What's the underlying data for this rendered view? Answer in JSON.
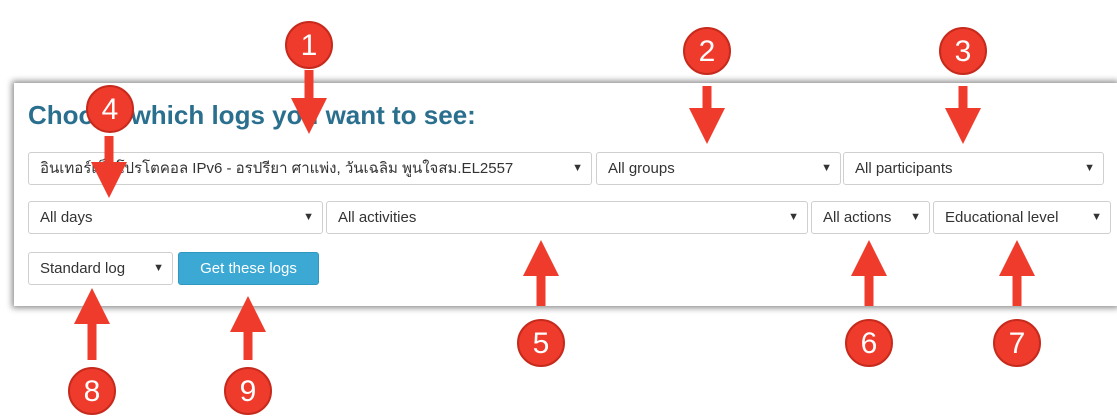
{
  "heading": "Choose which logs you want to see:",
  "filters": {
    "course": "อินเทอร์เน็ตโปรโตคอล IPv6 - อรปรียา ศาแพ่ง, วันเฉลิม พูนใจสม.EL2557",
    "groups": "All groups",
    "participants": "All participants",
    "days": "All days",
    "activities": "All activities",
    "actions": "All actions",
    "educational_level": "Educational level",
    "log_type": "Standard log"
  },
  "dropdown_glyph": "▼",
  "button_label": "Get these logs",
  "callouts": [
    "1",
    "2",
    "3",
    "4",
    "5",
    "6",
    "7",
    "8",
    "9"
  ],
  "colors": {
    "heading": "#2b6f8f",
    "button": "#3ba9d3",
    "callout": "#ef3b2c"
  }
}
